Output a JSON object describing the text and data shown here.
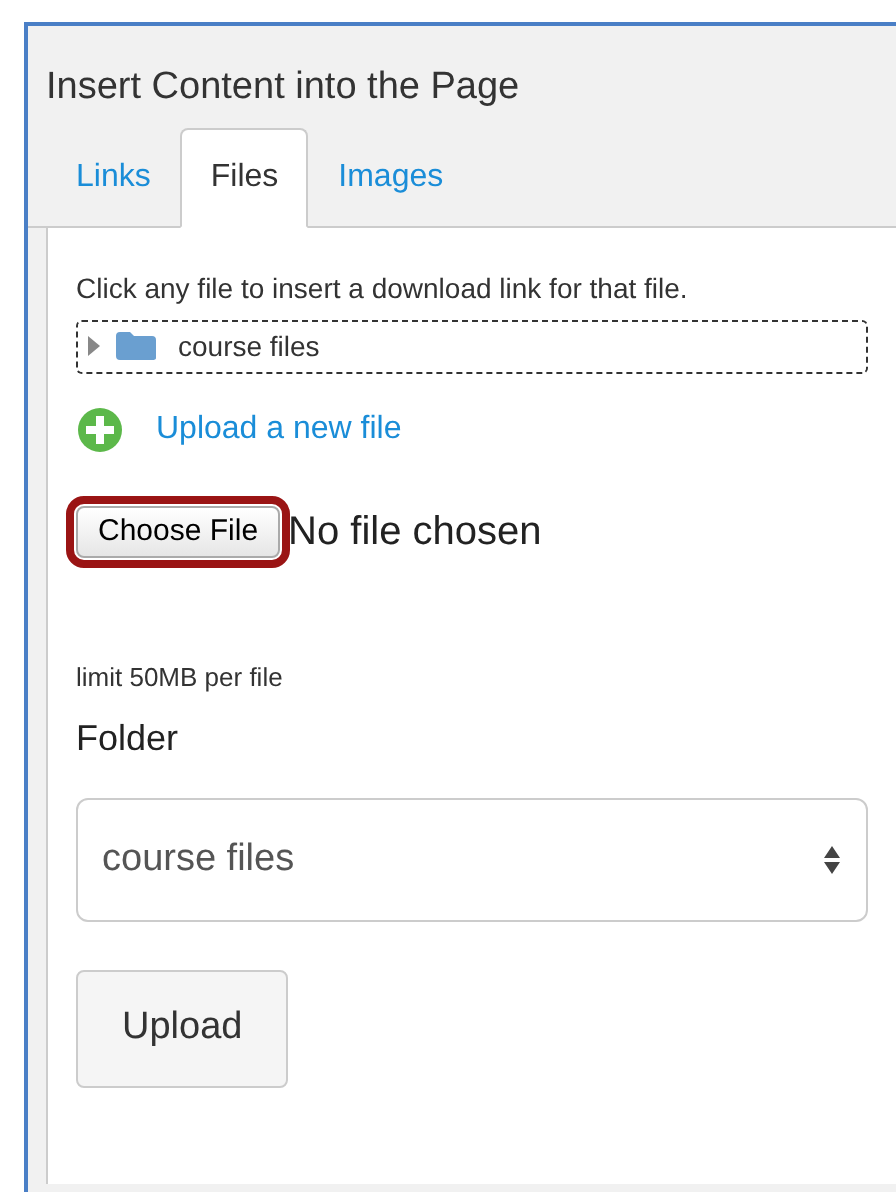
{
  "panel": {
    "title": "Insert Content into the Page"
  },
  "tabs": [
    {
      "label": "Links",
      "selected": false
    },
    {
      "label": "Files",
      "selected": true
    },
    {
      "label": "Images",
      "selected": false
    }
  ],
  "instructions": "Click any file to insert a download link for that file.",
  "tree": [
    {
      "label": "course files",
      "expanded": false
    }
  ],
  "upload_link": "Upload a new file",
  "file_input": {
    "button": "Choose File",
    "status": "No file chosen",
    "highlighted": true
  },
  "limit_note": "limit 50MB per file",
  "folder": {
    "label": "Folder",
    "value": "course files"
  },
  "upload_button": "Upload"
}
